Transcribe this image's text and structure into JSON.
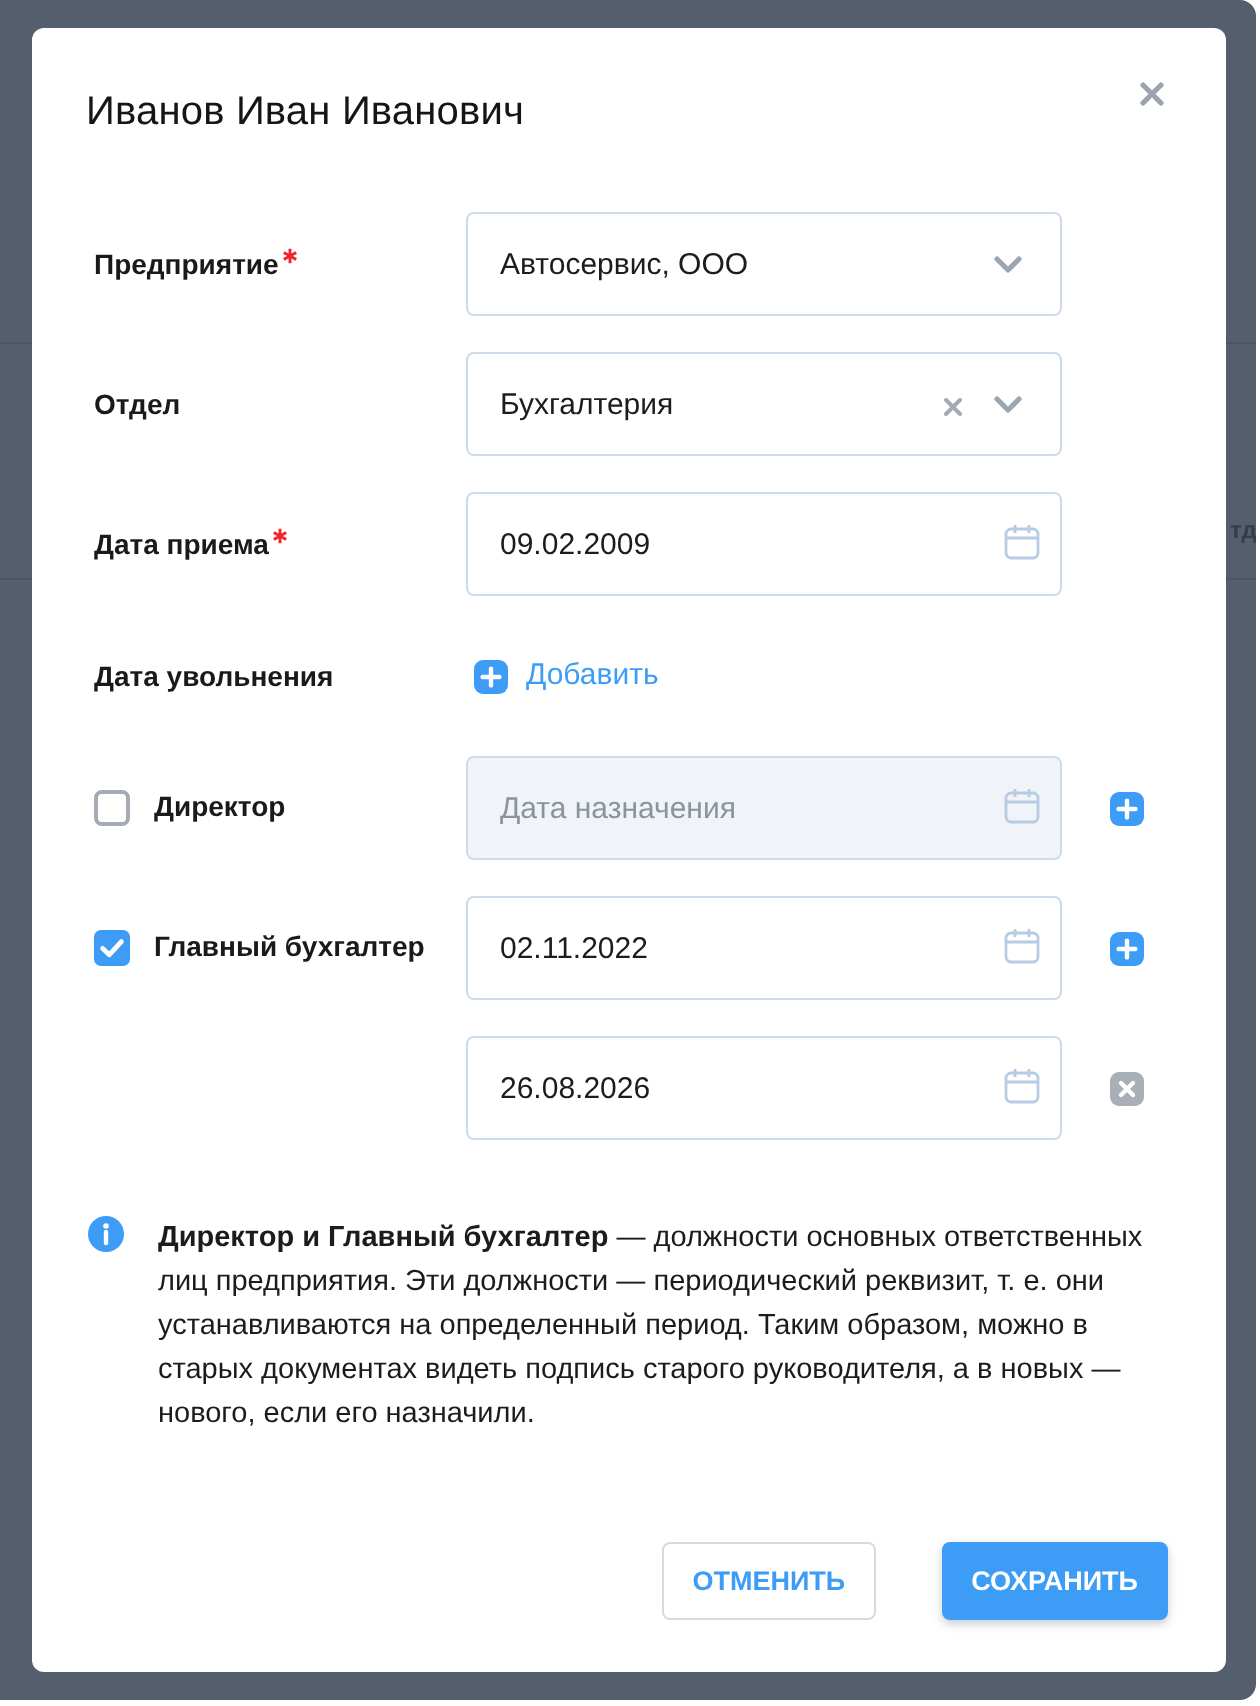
{
  "backdrop": {
    "text_fragment": "тд"
  },
  "dialog": {
    "title": "Иванов Иван Иванович"
  },
  "fields": [
    {
      "kind": "select",
      "label": "Предприятие",
      "required": true,
      "value": "Автосервис, ООО",
      "clearable": false
    },
    {
      "kind": "select",
      "label": "Отдел",
      "required": false,
      "value": "Бухгалтерия",
      "clearable": true
    },
    {
      "kind": "date",
      "label": "Дата приема",
      "required": true,
      "value": "09.02.2009"
    },
    {
      "kind": "add_link",
      "label": "Дата увольнения",
      "required": false,
      "link": "Добавить"
    }
  ],
  "positions": [
    {
      "label": "Директор",
      "checked": false,
      "dates": [
        {
          "kind": "add",
          "placeholder": "Дата назначения",
          "disabled": true
        }
      ]
    },
    {
      "label": "Главный бухгалтер",
      "checked": true,
      "dates": [
        {
          "kind": "add",
          "value": "02.11.2022",
          "disabled": false
        },
        {
          "kind": "remove",
          "value": "26.08.2026",
          "disabled": false
        }
      ]
    }
  ],
  "info": {
    "text": "**Директор и Главный бухгалтер** — должности основных ответственных лиц предприятия. Эти должности — периодический реквизит, т. е. они устанавливаются на определенный период. Таким образом, можно в старых документах видеть подпись старого руководителя, а в новых — нового, если его назначили."
  },
  "buttons": [
    {
      "kind": "cancel",
      "label": "ОТМЕНИТЬ"
    },
    {
      "kind": "save",
      "label": "СОХРАНИТЬ"
    }
  ]
}
